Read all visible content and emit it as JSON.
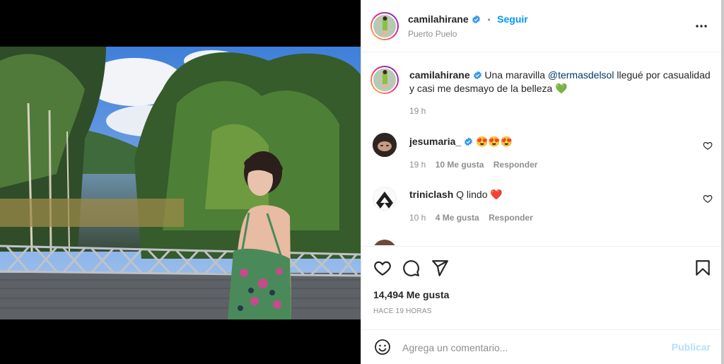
{
  "post": {
    "username": "camilahirane",
    "follow_label": "Seguir",
    "separator": "•",
    "location": "Puerto Puelo"
  },
  "caption": {
    "username": "camilahirane",
    "text_before": "Una maravilla ",
    "mention": "@termasdelsol",
    "text_after": " llegué por casualidad y casi me desmayo de la belleza",
    "emoji": "💚",
    "time": "19 h"
  },
  "comments": [
    {
      "username": "jesumaria_",
      "text": "😍😍😍",
      "time": "19 h",
      "likes": "10 Me gusta",
      "reply": "Responder"
    },
    {
      "username": "triniclash",
      "text": "Q lindo ❤️",
      "time": "10 h",
      "likes": "4 Me gusta",
      "reply": "Responder"
    }
  ],
  "actions": {
    "likes_count": "14,494 Me gusta",
    "time_ago": "HACE 19 HORAS"
  },
  "composer": {
    "placeholder": "Agrega un comentario...",
    "publish": "Publicar"
  },
  "colors": {
    "accent": "#0095f6",
    "verified": "#3897f0",
    "mention": "#00376b",
    "muted": "#8e8e8e"
  }
}
